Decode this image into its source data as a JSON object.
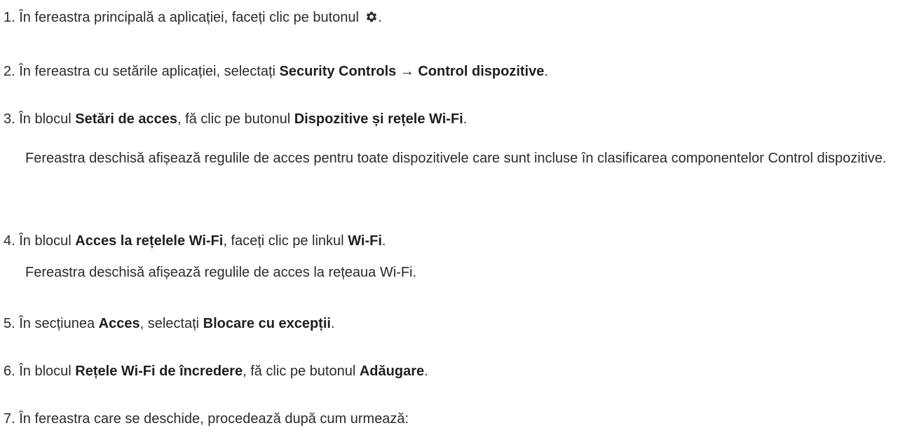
{
  "steps": [
    {
      "num": "1.",
      "text_a": " În fereastra principală a aplicației, faceți clic pe butonul ",
      "icon": "gear-icon",
      "text_b": "."
    },
    {
      "num": "2.",
      "text_a": " În fereastra cu setările aplicației, selectați ",
      "bold_a": "Security Controls → Control dispozitive",
      "text_b": "."
    },
    {
      "num": "3.",
      "text_a": " În blocul ",
      "bold_a": "Setări de acces",
      "text_b": ", fă clic pe butonul ",
      "bold_b": "Dispozitive și rețele Wi-Fi",
      "text_c": ".",
      "note": "Fereastra deschisă afișează regulile de acces pentru toate dispozitivele care sunt incluse în clasificarea componentelor Control dispozitive."
    },
    {
      "num": "4.",
      "text_a": " În blocul ",
      "bold_a": "Acces la rețelele Wi-Fi",
      "text_b": ", faceți clic pe linkul ",
      "bold_b": "Wi-Fi",
      "text_c": ".",
      "note": "Fereastra deschisă afișează regulile de acces la rețeaua Wi-Fi."
    },
    {
      "num": "5.",
      "text_a": " În secțiunea ",
      "bold_a": "Acces",
      "text_b": ", selectați ",
      "bold_b": "Blocare cu excepții",
      "text_c": "."
    },
    {
      "num": "6.",
      "text_a": " În blocul ",
      "bold_a": "Rețele Wi-Fi de încredere",
      "text_b": ", fă clic pe butonul ",
      "bold_b": "Adăugare",
      "text_c": "."
    },
    {
      "num": "7.",
      "text_a": " În fereastra care se deschide, procedează după cum urmează:"
    }
  ]
}
